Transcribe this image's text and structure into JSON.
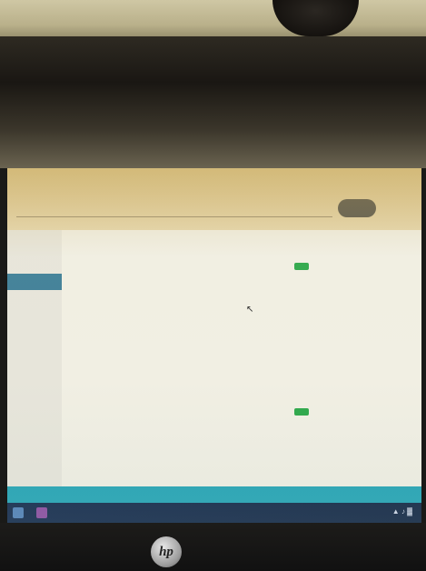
{
  "search": {
    "placeholder": "",
    "button_label": ""
  },
  "main": {
    "section_title": "",
    "records": [
      {
        "title": "",
        "badge": "",
        "fields_left": [
          {
            "label": "",
            "value": ""
          },
          {
            "label": "",
            "value": ""
          },
          {
            "label": "",
            "value": ""
          },
          {
            "label": "",
            "value": ""
          },
          {
            "label": "",
            "value": ""
          }
        ],
        "fields_right": [
          {
            "label": "",
            "value": ""
          },
          {
            "label": "",
            "value": ""
          },
          {
            "label": "",
            "value": ""
          },
          {
            "label": "",
            "value": ""
          }
        ]
      },
      {
        "title": "",
        "badge": "",
        "fields_left": [
          {
            "label": "",
            "value": ""
          },
          {
            "label": "",
            "value": ""
          },
          {
            "label": "",
            "value": ""
          }
        ],
        "fields_right": [
          {
            "label": "",
            "value": ""
          },
          {
            "label": "",
            "value": ""
          }
        ]
      }
    ]
  },
  "taskbar": {
    "tray_icons": [
      "volume-icon",
      "network-icon",
      "notification-icon"
    ]
  },
  "device": {
    "logo": "hp"
  },
  "colors": {
    "accent_teal": "#21a3b3",
    "record_title_red": "#b23a2a",
    "badge_green": "#2ea84a",
    "sidebar_active": "#3f7f98",
    "taskbar_navy": "#11284a"
  }
}
